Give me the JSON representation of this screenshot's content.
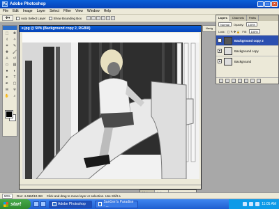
{
  "window": {
    "title": "Adobe Photoshop",
    "app_icon": "Ps"
  },
  "menu": [
    "File",
    "Edit",
    "Image",
    "Layer",
    "Select",
    "Filter",
    "View",
    "Window",
    "Help"
  ],
  "options": {
    "auto_select": "Auto Select Layer",
    "show_bounding": "Show Bounding Box"
  },
  "document": {
    "title": "e.jpg @ 50% (Background copy 2, RGB/8)"
  },
  "navigator_tab": "Navig",
  "layers_palette": {
    "tabs": [
      "Layers",
      "Channels",
      "Paths"
    ],
    "blend_mode": "Normal",
    "opacity_label": "Opacity:",
    "opacity_value": "100%",
    "lock_label": "Lock:",
    "fill_label": "Fill:",
    "fill_value": "100%",
    "layers": [
      {
        "name": "Background copy 2",
        "selected": true
      },
      {
        "name": "Background copy",
        "selected": false
      },
      {
        "name": "Background",
        "selected": false
      }
    ]
  },
  "history_palette": {
    "tabs": [
      "History",
      "Actions"
    ]
  },
  "status": {
    "zoom": "50%",
    "doc_size": "Doc: 4.46M/10.3M",
    "hint": "Click and drag to move layer or selection. Use Shift a"
  },
  "taskbar": {
    "start": "start",
    "buttons": [
      "Adobe Photoshop",
      "SanGeri's Paradise - ..."
    ],
    "clock": "11:05 AM"
  },
  "colors": {
    "title_blue": "#0642b8",
    "selection": "#2b4fb0",
    "taskbar": "#1f5fd0",
    "start_green": "#2f8a2f"
  }
}
